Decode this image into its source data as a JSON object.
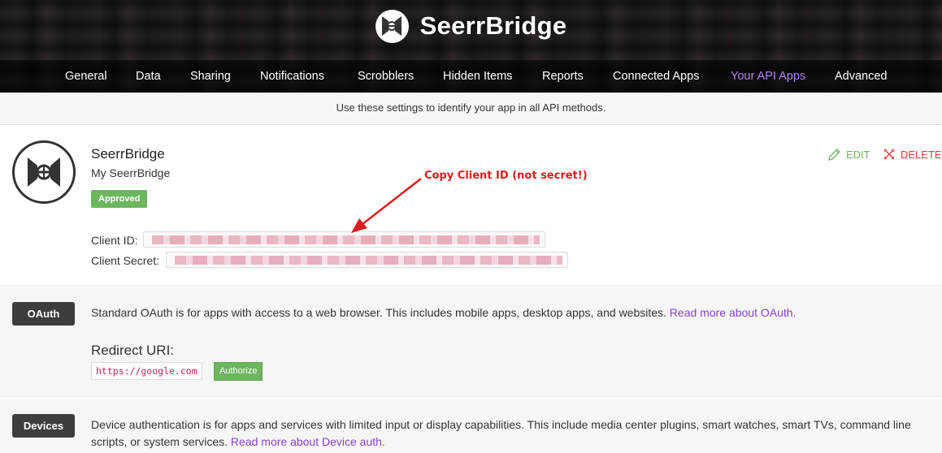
{
  "brand": {
    "name": "SeerrBridge",
    "logo_icon": "tie-fighter-icon"
  },
  "nav": {
    "items": [
      {
        "label": "General"
      },
      {
        "label": "Data"
      },
      {
        "label": "Sharing"
      },
      {
        "label": "Notifications"
      },
      {
        "label": "Scrobblers"
      },
      {
        "label": "Hidden Items"
      },
      {
        "label": "Reports"
      },
      {
        "label": "Connected Apps"
      },
      {
        "label": "Your API Apps",
        "active": true
      },
      {
        "label": "Advanced"
      }
    ],
    "active_color": "#b583e8"
  },
  "info_text": "Use these settings to identify your app in all API methods.",
  "app": {
    "name": "SeerrBridge",
    "description": "My SeerrBridge",
    "status": "Approved",
    "edit_label": "EDIT",
    "delete_label": "DELETE",
    "client_id_label": "Client ID:",
    "client_secret_label": "Client Secret:",
    "annotation": "Copy Client ID (not secret!)"
  },
  "oauth": {
    "pill": "OAuth",
    "text": "Standard OAuth is for apps with access to a web browser. This includes mobile apps, desktop apps, and websites.",
    "link": "Read more about OAuth.",
    "redirect_heading": "Redirect URI:",
    "redirect_uri": "https://google.com",
    "authorize_label": "Authorize"
  },
  "devices": {
    "pill": "Devices",
    "text": "Device authentication is for apps and services with limited input or display capabilities. This include media center plugins, smart watches, smart TVs, command line scripts, or system services.",
    "link": "Read more about Device auth."
  },
  "colors": {
    "green": "#6bb65e",
    "red": "#e03a3a",
    "purple_link": "#8a3fd1",
    "annotation_red": "#e01b1b"
  }
}
